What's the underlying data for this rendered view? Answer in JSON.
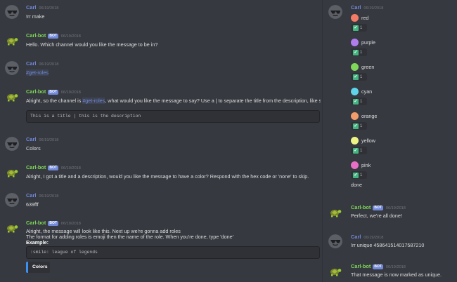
{
  "colors": {
    "background": "#36393f",
    "user_name": "#7289da",
    "bot_name": "#7fd859",
    "bot_tag": "#7289da",
    "timestamp": "#72767d",
    "text": "#dcddde",
    "embed_accent": "#3a91f0",
    "reaction_check": "#43b581"
  },
  "icons": {
    "user_avatar": "sunglasses-face-icon",
    "bot_avatar": "turtle-icon",
    "reaction": "white-check-mark-icon"
  },
  "left_messages": [
    {
      "author": "Carl",
      "time": "06/19/2018",
      "lines": [
        "!rr make"
      ]
    },
    {
      "author": "Carl-bot",
      "bot_tag": "BOT",
      "time": "06/19/2018",
      "lines": [
        "Hello. Which channel would you like the message to be in?"
      ]
    },
    {
      "author": "Carl",
      "time": "06/19/2018",
      "lines": [
        "#get-roles"
      ]
    },
    {
      "author": "Carl-bot",
      "bot_tag": "BOT",
      "time": "06/19/2018",
      "line_pre": "Alright, so the channel is ",
      "line_mention": "#get-roles",
      "line_post": ", what would you like the message to say? Use a | to separate the title from the description, like so",
      "code": "This is a title | this is the description"
    },
    {
      "author": "Carl",
      "time": "06/19/2018",
      "lines": [
        "Colors"
      ]
    },
    {
      "author": "Carl-bot",
      "bot_tag": "BOT",
      "time": "06/19/2018",
      "lines": [
        "Alright, I got a title and a description, would you like the message to have a color? Respond with the hex code or 'none' to skip."
      ]
    },
    {
      "author": "Carl",
      "time": "06/19/2018",
      "lines": [
        "639fff"
      ]
    },
    {
      "author": "Carl-bot",
      "bot_tag": "BOT",
      "time": "06/19/2018",
      "lines": [
        "Alright, the message will look like this. Next up we're gonna add roles",
        "The format for adding roles is emoji then the name of the role. When you're done, type 'done'",
        "Example:"
      ],
      "code": ":smile: league of legends",
      "embed_title": "Colors"
    }
  ],
  "right": {
    "top_author": "Carl",
    "top_time": "06/19/2018",
    "roles": [
      {
        "name": "red",
        "color": "#f47b67"
      },
      {
        "name": "purple",
        "color": "#b07ded"
      },
      {
        "name": "green",
        "color": "#7fd859"
      },
      {
        "name": "cyan",
        "color": "#5fd3e8"
      },
      {
        "name": "orange",
        "color": "#f29c6b"
      },
      {
        "name": "yellow",
        "color": "#ecf285"
      },
      {
        "name": "pink",
        "color": "#e86fc6"
      }
    ],
    "reaction_count": "1",
    "done_text": "done",
    "messages": [
      {
        "author": "Carl-bot",
        "bot_tag": "BOT",
        "time": "06/19/2018",
        "text": "Perfect, we're all done!"
      },
      {
        "author": "Carl",
        "time": "06/19/2018",
        "text": "!rr unique 458641514017587210"
      },
      {
        "author": "Carl-bot",
        "bot_tag": "BOT",
        "time": "06/19/2018",
        "text": "That message is now marked as unique."
      }
    ]
  }
}
